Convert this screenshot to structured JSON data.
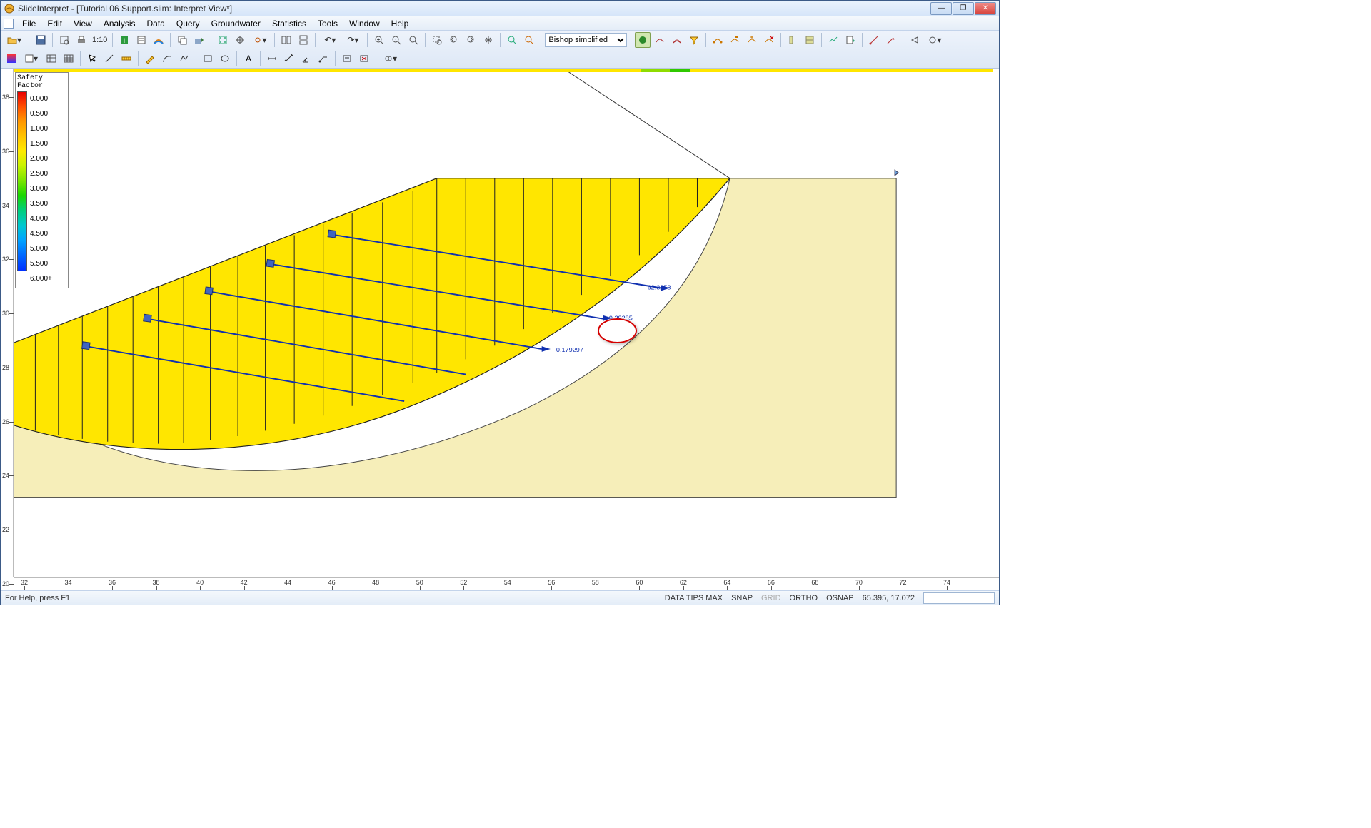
{
  "window": {
    "app_name": "SlideInterpret",
    "document": "[Tutorial 06 Support.slim: Interpret View*]",
    "min": "—",
    "restore": "❐",
    "close": "✕"
  },
  "menubar": {
    "items": [
      "File",
      "Edit",
      "View",
      "Analysis",
      "Data",
      "Query",
      "Groundwater",
      "Statistics",
      "Tools",
      "Window",
      "Help"
    ]
  },
  "toolbar": {
    "ratio": "1:10",
    "method_selected": "Bishop simplified"
  },
  "legend": {
    "title": "Safety Factor",
    "labels": [
      "0.000",
      "0.500",
      "1.000",
      "1.500",
      "2.000",
      "2.500",
      "3.000",
      "3.500",
      "4.000",
      "4.500",
      "5.000",
      "5.500",
      "6.000+"
    ]
  },
  "annotations": {
    "v1": "62.3258",
    "v2": "9.29285",
    "v3": "0.179297"
  },
  "ruler": {
    "x": [
      "32",
      "34",
      "36",
      "38",
      "40",
      "42",
      "44",
      "46",
      "48",
      "50",
      "52",
      "54",
      "56",
      "58",
      "60",
      "62",
      "64",
      "66",
      "68",
      "70",
      "72",
      "74"
    ],
    "y": [
      "20",
      "22",
      "24",
      "26",
      "28",
      "30",
      "32",
      "34",
      "36",
      "38"
    ]
  },
  "status": {
    "help": "For Help, press F1",
    "tips": "DATA TIPS MAX",
    "snap": "SNAP",
    "grid": "GRID",
    "ortho": "ORTHO",
    "osnap": "OSNAP",
    "coords": "65.395, 17.072"
  }
}
